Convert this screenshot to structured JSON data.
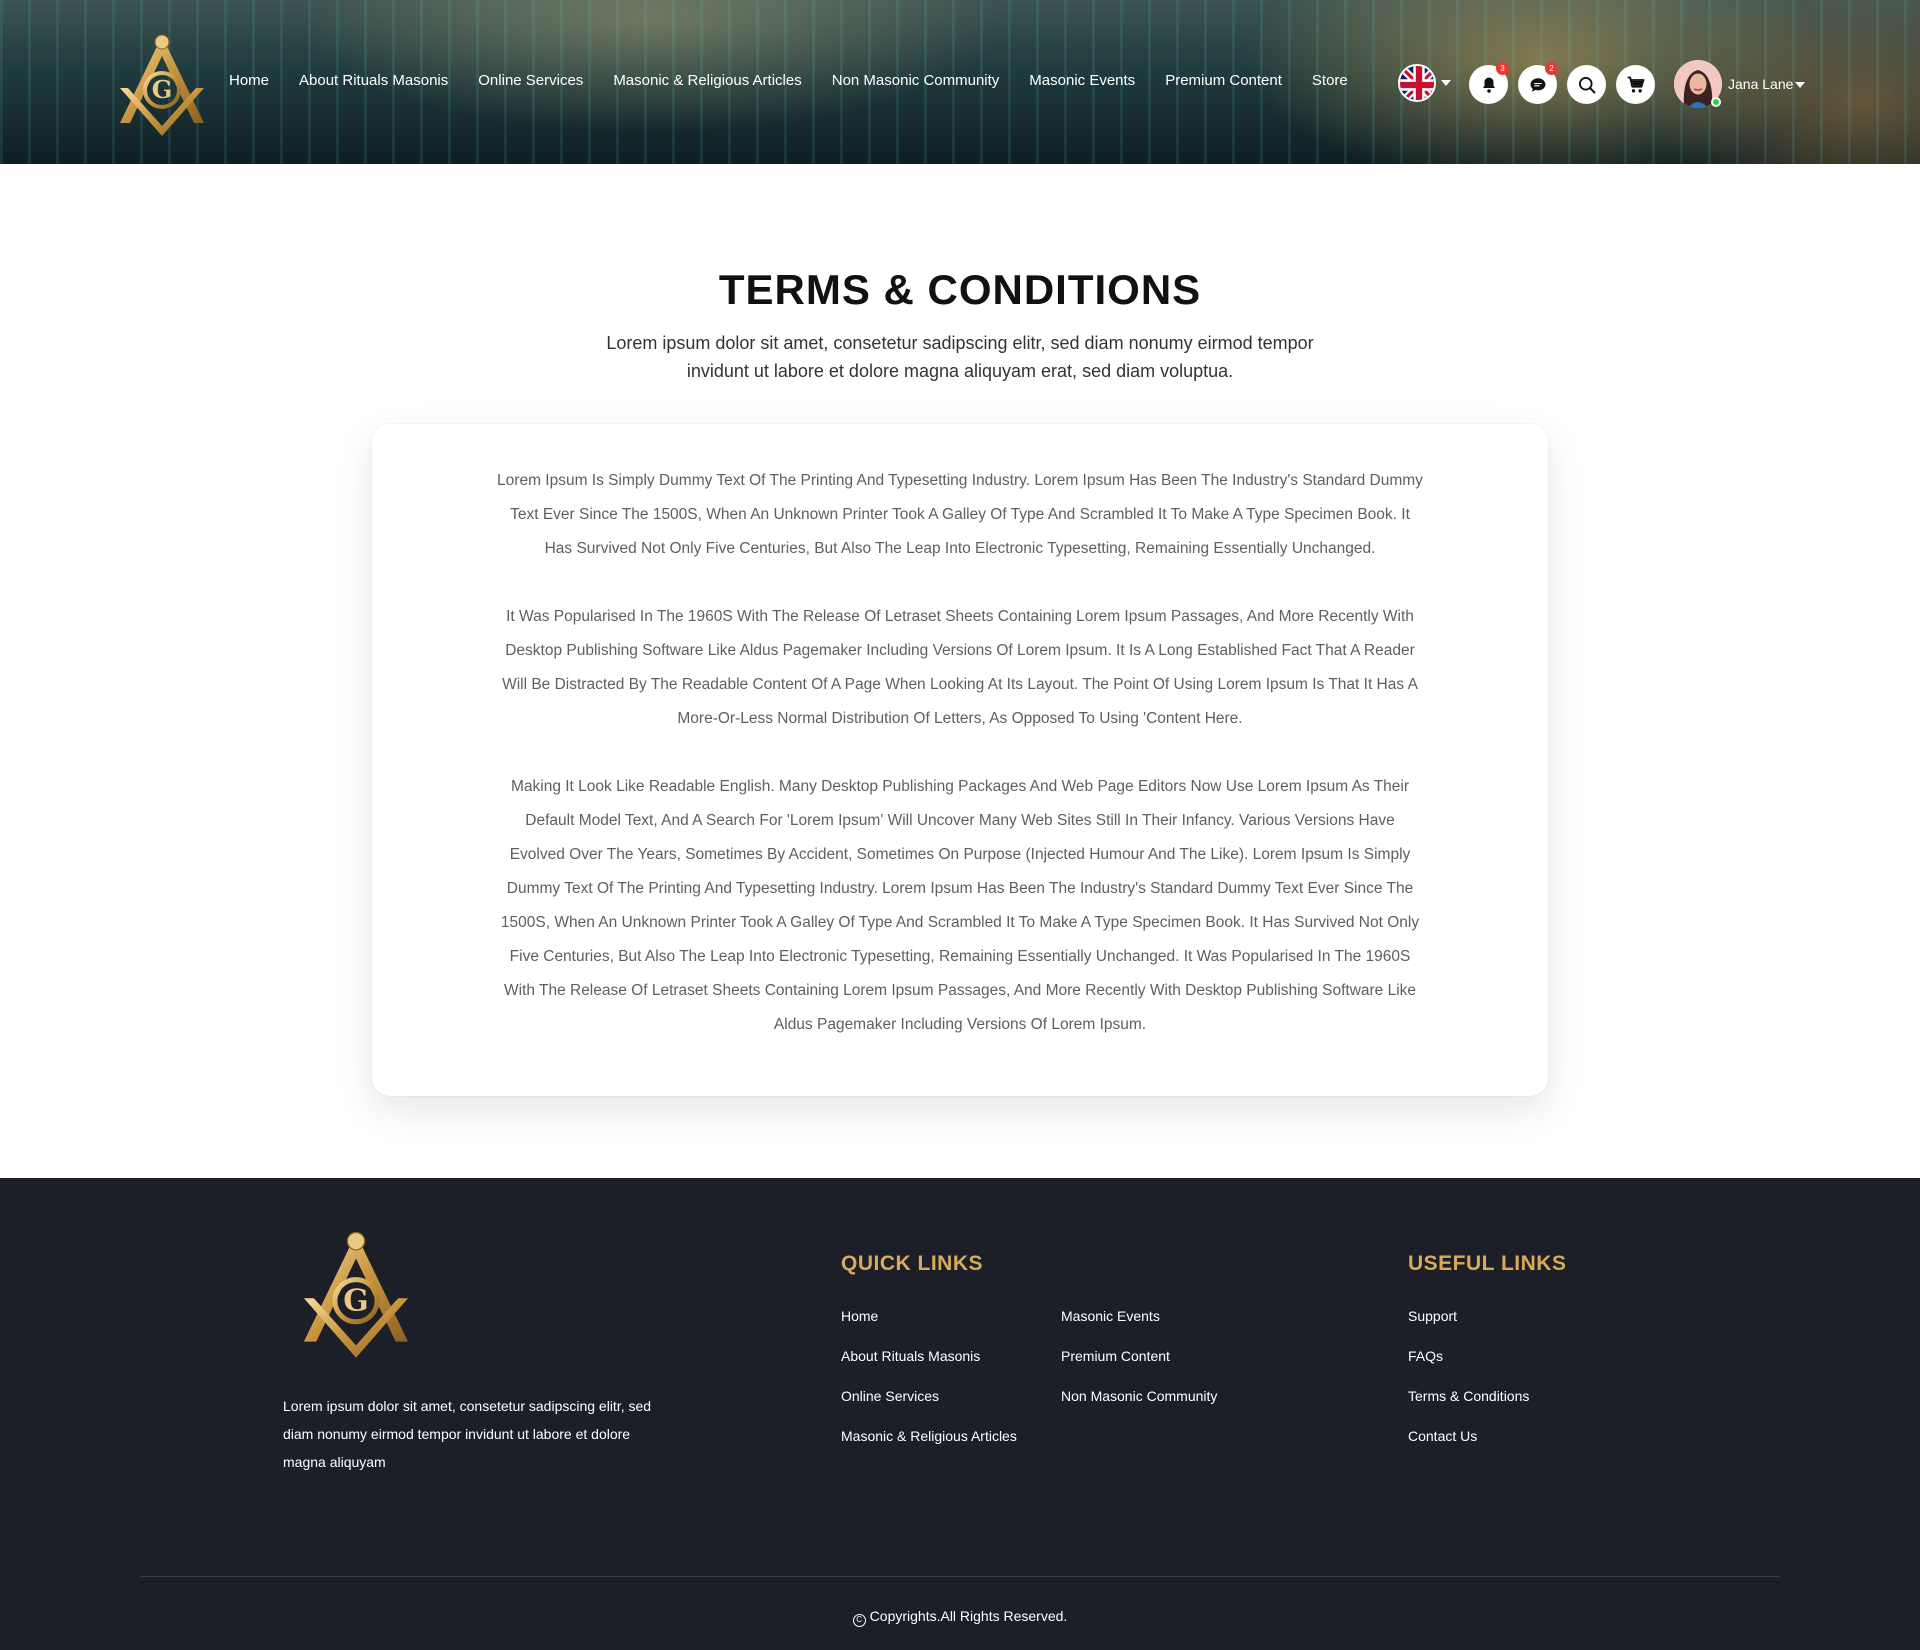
{
  "header": {
    "nav": [
      "Home",
      "About Rituals Masonis",
      "Online Services",
      "Masonic & Religious Articles",
      "Non Masonic Community",
      "Masonic Events",
      "Premium Content",
      "Store"
    ],
    "notifications_count": "3",
    "messages_count": "2",
    "user_name": "Jana Lane",
    "icons": [
      "masonic-logo",
      "uk-flag-icon",
      "bell-icon",
      "chat-icon",
      "search-icon",
      "cart-icon"
    ]
  },
  "main": {
    "title": "TERMS & CONDITIONS",
    "subtitle": "Lorem ipsum dolor sit amet, consetetur sadipscing elitr, sed diam nonumy eirmod tempor invidunt ut labore et dolore magna aliquyam erat, sed diam voluptua.",
    "paragraphs": [
      "Lorem Ipsum Is Simply Dummy Text Of The Printing And Typesetting Industry. Lorem Ipsum Has Been The Industry's Standard Dummy Text Ever Since The 1500S, When An Unknown Printer Took A Galley Of Type And Scrambled It To Make A Type Specimen Book. It Has Survived Not Only Five Centuries, But Also The Leap Into Electronic Typesetting, Remaining Essentially Unchanged.",
      "It Was Popularised In The 1960S With The Release Of Letraset Sheets Containing Lorem Ipsum Passages, And More Recently With Desktop Publishing Software Like Aldus Pagemaker Including Versions Of Lorem Ipsum. It Is A Long Established Fact That A Reader Will Be Distracted By The Readable Content Of A Page When Looking At Its Layout. The Point Of Using Lorem Ipsum Is That It Has A More-Or-Less Normal Distribution Of Letters, As Opposed To Using 'Content Here.",
      "Making It Look Like Readable English. Many Desktop Publishing Packages And Web Page Editors Now Use Lorem Ipsum As Their Default Model Text, And A Search For 'Lorem Ipsum' Will Uncover Many Web Sites Still In Their Infancy. Various Versions Have Evolved Over The Years, Sometimes By Accident, Sometimes On Purpose (Injected Humour And The Like). Lorem Ipsum Is Simply Dummy Text Of The Printing And Typesetting Industry. Lorem Ipsum Has Been The Industry's Standard Dummy Text Ever Since The 1500S, When An Unknown Printer Took A Galley Of Type And Scrambled It To Make A Type Specimen Book. It Has Survived Not Only Five Centuries, But Also The Leap Into Electronic Typesetting, Remaining Essentially Unchanged. It Was Popularised In The 1960S With The Release Of Letraset Sheets Containing Lorem Ipsum Passages, And More Recently With Desktop Publishing Software Like Aldus Pagemaker Including Versions Of Lorem Ipsum."
    ]
  },
  "footer": {
    "description": "Lorem ipsum dolor sit amet, consetetur sadipscing elitr, sed diam nonumy eirmod tempor invidunt ut labore et dolore magna aliquyam",
    "quick_links_heading": "QUICK LINKS",
    "quick_links_col1": [
      "Home",
      "About Rituals Masonis",
      "Online Services",
      "Masonic & Religious Articles"
    ],
    "quick_links_col2": [
      "Masonic Events",
      "Premium Content",
      "Non Masonic Community"
    ],
    "useful_links_heading": "USEFUL LINKS",
    "useful_links": [
      "Support",
      "FAQs",
      "Terms & Conditions",
      "Contact Us"
    ],
    "copyright": "Copyrights.All Rights Reserved.",
    "accent_color": "#d9aa5a"
  }
}
